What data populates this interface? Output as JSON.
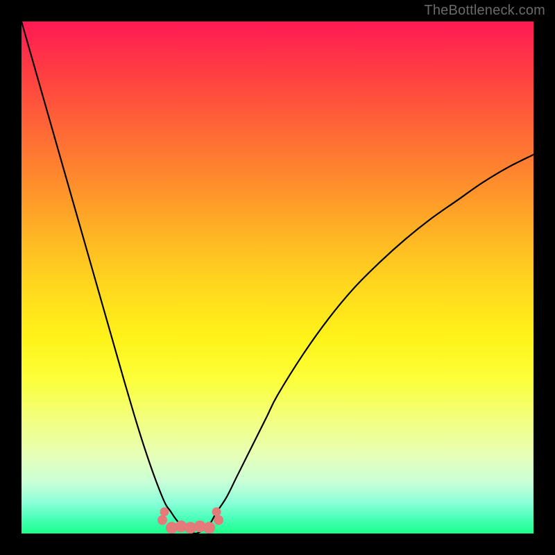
{
  "watermark": "TheBottleneck.com",
  "chart_data": {
    "type": "line",
    "title": "",
    "xlabel": "",
    "ylabel": "",
    "x": [
      0.0,
      0.02,
      0.04,
      0.06,
      0.08,
      0.1,
      0.12,
      0.14,
      0.16,
      0.18,
      0.2,
      0.22,
      0.24,
      0.26,
      0.28,
      0.29,
      0.3,
      0.31,
      0.32,
      0.33,
      0.34,
      0.35,
      0.36,
      0.37,
      0.38,
      0.4,
      0.42,
      0.44,
      0.46,
      0.48,
      0.5,
      0.55,
      0.6,
      0.65,
      0.7,
      0.75,
      0.8,
      0.85,
      0.9,
      0.95,
      1.0
    ],
    "values": [
      1.0,
      0.93,
      0.86,
      0.79,
      0.72,
      0.65,
      0.58,
      0.51,
      0.44,
      0.37,
      0.3,
      0.232,
      0.168,
      0.11,
      0.06,
      0.045,
      0.03,
      0.018,
      0.01,
      0.004,
      0.0,
      0.004,
      0.01,
      0.022,
      0.04,
      0.07,
      0.11,
      0.15,
      0.19,
      0.23,
      0.27,
      0.35,
      0.42,
      0.48,
      0.53,
      0.575,
      0.615,
      0.65,
      0.685,
      0.715,
      0.74
    ],
    "xlim": [
      0,
      1
    ],
    "ylim": [
      0,
      1
    ],
    "marker_band": {
      "y": 0.018,
      "x_range": [
        0.275,
        0.385
      ],
      "color": "#e47a7a"
    },
    "gradient_stops": [
      {
        "pos": 0.0,
        "color": "#ff1a53"
      },
      {
        "pos": 0.5,
        "color": "#fff31a"
      },
      {
        "pos": 1.0,
        "color": "#1aff88"
      }
    ]
  }
}
